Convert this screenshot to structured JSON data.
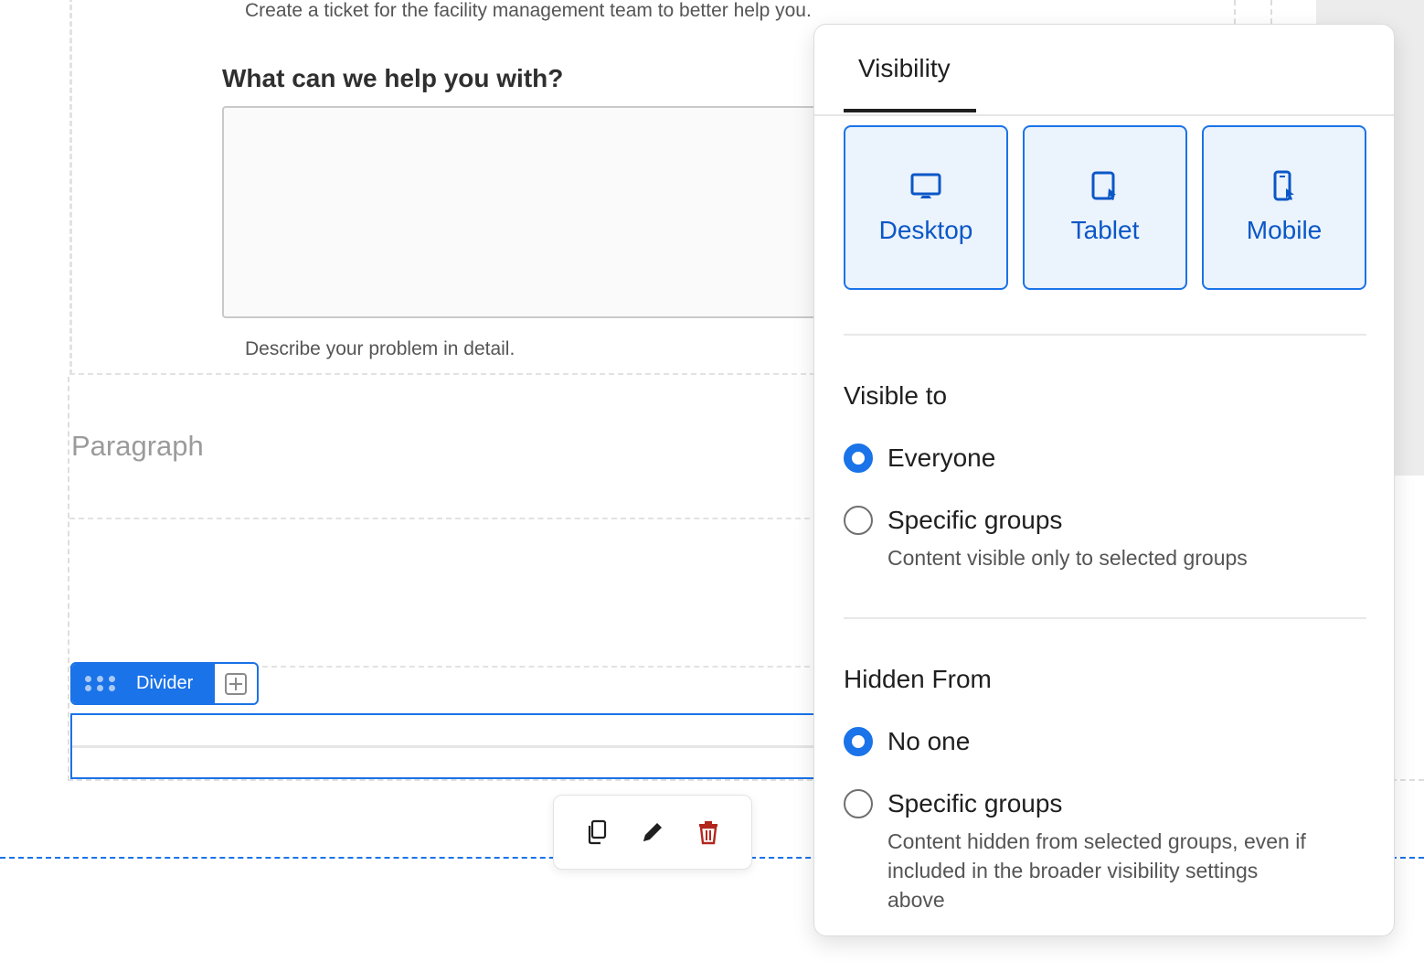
{
  "editor": {
    "ticket_description": "Create a ticket for the facility management team to better help you.",
    "question_label": "What can we help you with?",
    "question_helper": "Describe your problem in detail.",
    "paragraph_placeholder": "Paragraph",
    "divider_chip_label": "Divider"
  },
  "action_bar": {
    "icons": [
      "copy-icon",
      "pencil-icon",
      "trash-icon"
    ],
    "delete_color": "#b3261e"
  },
  "panel": {
    "tab_label": "Visibility",
    "devices": [
      {
        "label": "Desktop",
        "icon": "desktop-icon"
      },
      {
        "label": "Tablet",
        "icon": "tablet-icon"
      },
      {
        "label": "Mobile",
        "icon": "mobile-icon"
      }
    ],
    "visible_to": {
      "title": "Visible to",
      "options": [
        {
          "label": "Everyone",
          "checked": true,
          "desc": ""
        },
        {
          "label": "Specific groups",
          "checked": false,
          "desc": "Content visible only to selected groups"
        }
      ]
    },
    "hidden_from": {
      "title": "Hidden From",
      "options": [
        {
          "label": "No one",
          "checked": true,
          "desc": ""
        },
        {
          "label": "Specific groups",
          "checked": false,
          "desc": "Content hidden from selected groups, even if included in the broader visibility settings above"
        }
      ]
    }
  },
  "colors": {
    "accent": "#1a73e8",
    "device_bg": "#ebf3fd",
    "device_text": "#0b57c6"
  }
}
